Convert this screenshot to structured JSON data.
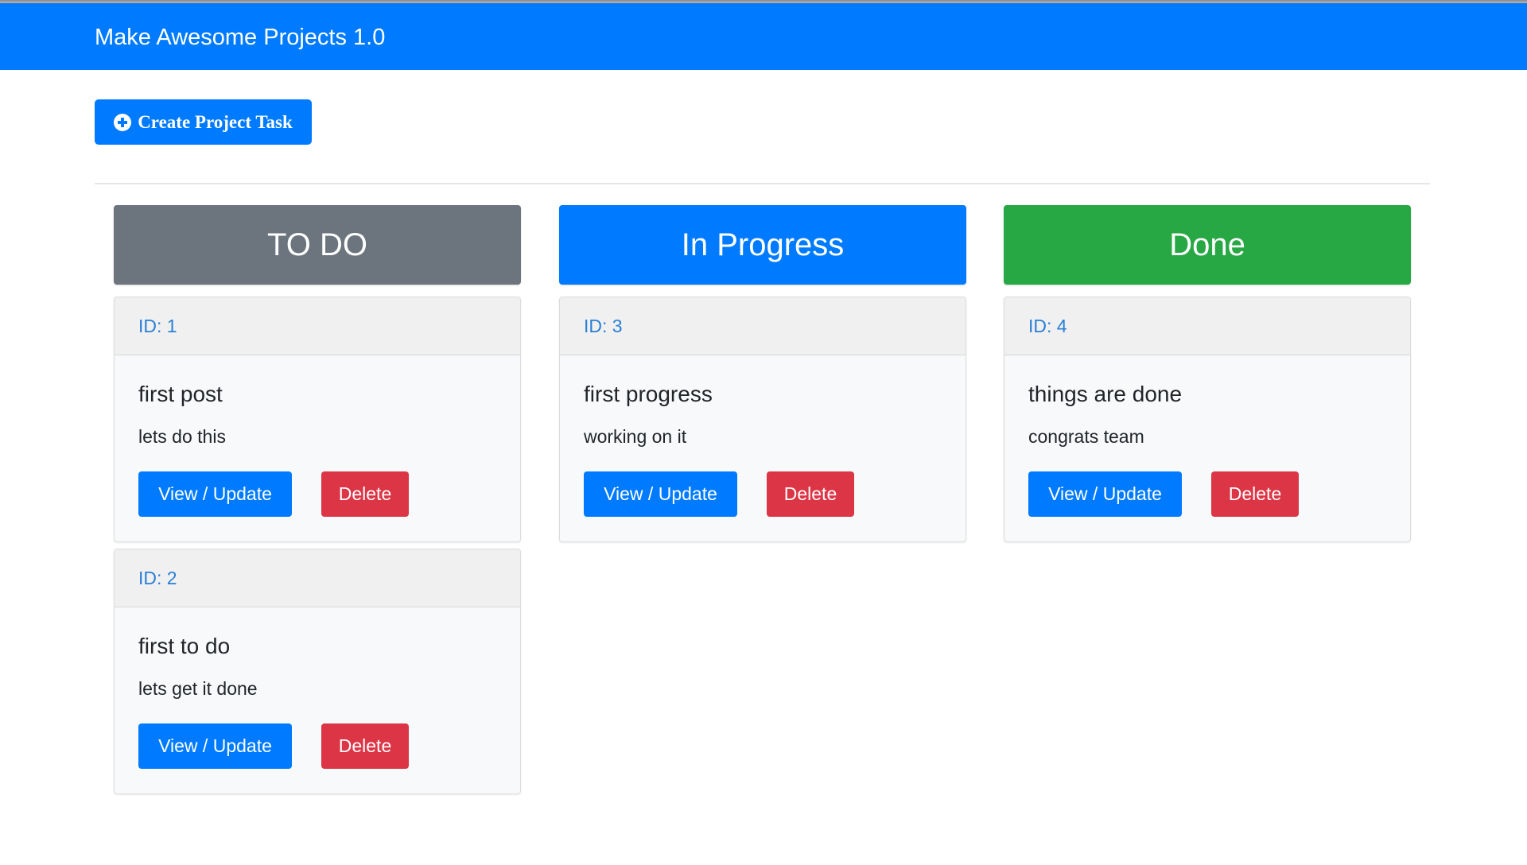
{
  "navbar": {
    "title": "Make Awesome Projects 1.0"
  },
  "toolbar": {
    "create_label": "Create Project Task",
    "create_icon": "plus-circle-icon"
  },
  "colors": {
    "primary": "#007bff",
    "secondary": "#6c757d",
    "success": "#28a745",
    "danger": "#dc3545"
  },
  "columns": [
    {
      "title": "TO DO",
      "color": "#6c757d",
      "cards": [
        {
          "id_label": "ID: 1",
          "title": "first post",
          "description": "lets do this",
          "view_label": "View / Update",
          "delete_label": "Delete"
        },
        {
          "id_label": "ID: 2",
          "title": "first to do",
          "description": "lets get it done",
          "view_label": "View / Update",
          "delete_label": "Delete"
        }
      ]
    },
    {
      "title": "In Progress",
      "color": "#007bff",
      "cards": [
        {
          "id_label": "ID: 3",
          "title": "first progress",
          "description": "working on it",
          "view_label": "View / Update",
          "delete_label": "Delete"
        }
      ]
    },
    {
      "title": "Done",
      "color": "#28a745",
      "cards": [
        {
          "id_label": "ID: 4",
          "title": "things are done",
          "description": "congrats team",
          "view_label": "View / Update",
          "delete_label": "Delete"
        }
      ]
    }
  ]
}
